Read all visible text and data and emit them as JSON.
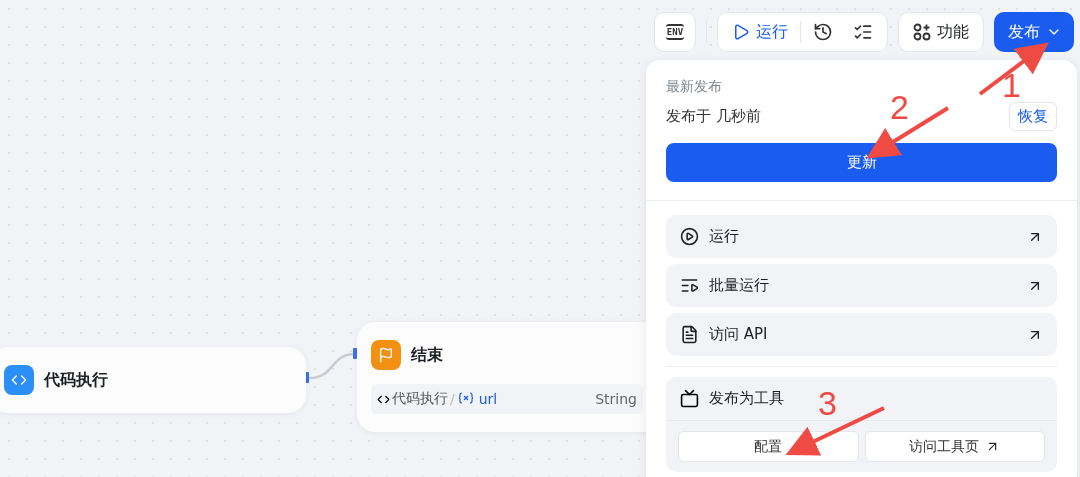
{
  "toolbar": {
    "env_label": "ENV",
    "run_label": "运行",
    "features_label": "功能",
    "publish_label": "发布"
  },
  "canvas": {
    "nodes": [
      {
        "kind": "code",
        "title": "代码执行"
      },
      {
        "kind": "end",
        "title": "结束",
        "output": {
          "source": "代码执行",
          "separator": "/",
          "variable": "url",
          "type": "String"
        }
      }
    ]
  },
  "publish_menu": {
    "heading": "最新发布",
    "status": "发布于 几秒前",
    "restore_label": "恢复",
    "update_label": "更新",
    "actions": [
      {
        "kind": "run",
        "label": "运行"
      },
      {
        "kind": "batch",
        "label": "批量运行"
      },
      {
        "kind": "api",
        "label": "访问 API"
      }
    ],
    "tool": {
      "title": "发布为工具",
      "configure_label": "配置",
      "visit_label": "访问工具页"
    }
  },
  "annotations": [
    {
      "number": "1"
    },
    {
      "number": "2"
    },
    {
      "number": "3"
    }
  ]
}
